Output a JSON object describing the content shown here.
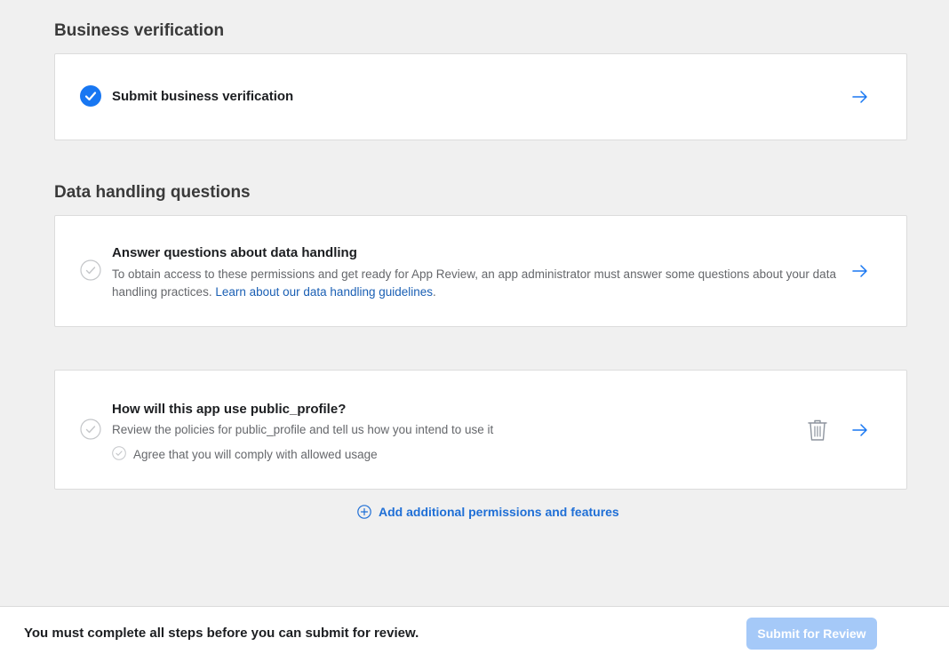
{
  "business_verification": {
    "section_title": "Business verification",
    "item": {
      "title": "Submit business verification",
      "status": "complete"
    }
  },
  "data_handling": {
    "section_title": "Data handling questions",
    "item": {
      "title": "Answer questions about data handling",
      "description": "To obtain access to these permissions and get ready for App Review, an app administrator must answer some questions about your data handling practices. ",
      "link_text": "Learn about our data handling guidelines",
      "link_suffix": ".",
      "status": "incomplete"
    }
  },
  "permission": {
    "title": "How will this app use public_profile?",
    "description": "Review the policies for public_profile and tell us how you intend to use it",
    "substep_label": "Agree that you will comply with allowed usage",
    "status": "incomplete"
  },
  "add_permissions": {
    "label": "Add additional permissions and features"
  },
  "footer": {
    "message": "You must complete all steps before you can submit for review.",
    "submit_label": "Submit for Review",
    "submit_enabled": false
  },
  "colors": {
    "accent": "#1877f2",
    "link": "#1a5fb4",
    "button_disabled": "#a5c9f8",
    "background": "#f0f0f0"
  },
  "icons": {
    "check_complete": "check-circle-filled-icon",
    "check_incomplete": "check-circle-outline-icon",
    "arrow": "arrow-right-icon",
    "trash": "trash-icon",
    "add": "plus-circle-icon"
  }
}
